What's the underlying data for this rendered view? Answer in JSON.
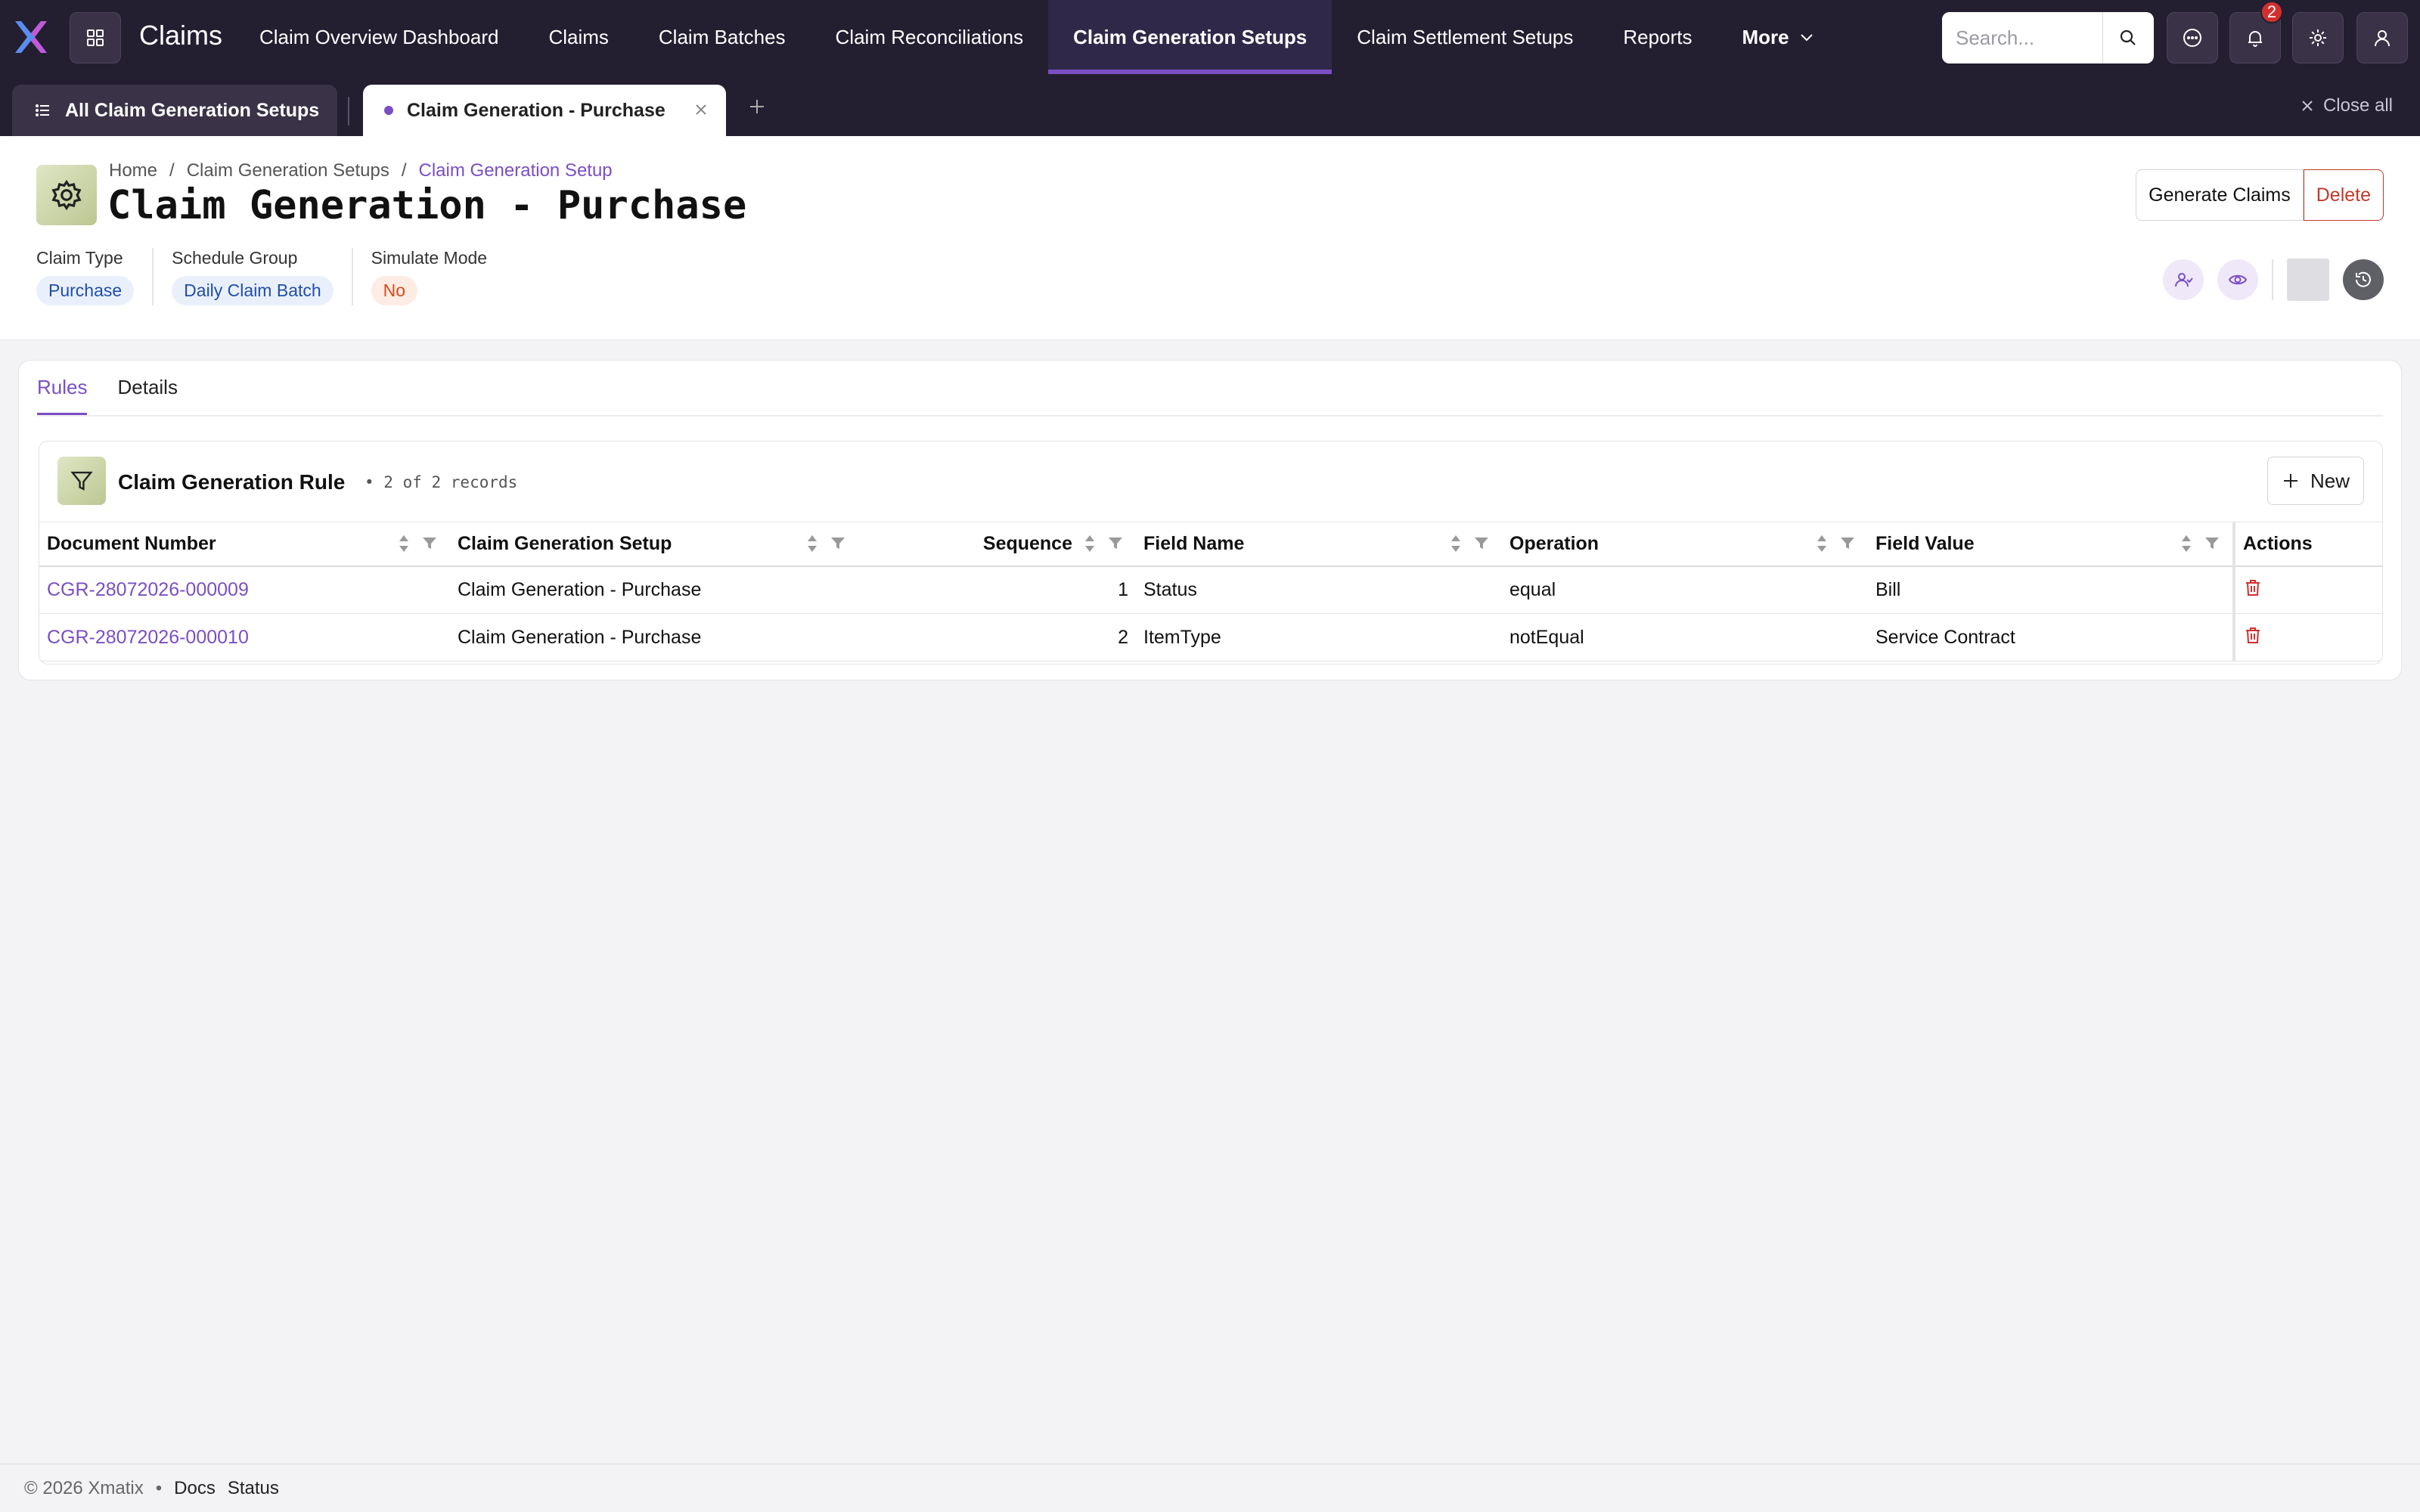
{
  "app": {
    "name": "Claims"
  },
  "nav": {
    "items": [
      {
        "label": "Claim Overview Dashboard"
      },
      {
        "label": "Claims"
      },
      {
        "label": "Claim Batches"
      },
      {
        "label": "Claim Reconciliations"
      },
      {
        "label": "Claim Generation Setups",
        "active": true
      },
      {
        "label": "Claim Settlement Setups"
      },
      {
        "label": "Reports"
      }
    ],
    "more_label": "More"
  },
  "search": {
    "placeholder": "Search..."
  },
  "notifications": {
    "count": "2"
  },
  "tabs": {
    "all_label": "All Claim Generation Setups",
    "current_label": "Claim Generation - Purchase",
    "close_all_label": "Close all"
  },
  "breadcrumb": {
    "home": "Home",
    "sep": "/",
    "parent": "Claim Generation Setups",
    "current": "Claim Generation Setup"
  },
  "page": {
    "title": "Claim Generation - Purchase"
  },
  "actions": {
    "generate_label": "Generate Claims",
    "delete_label": "Delete"
  },
  "properties": {
    "claim_type": {
      "label": "Claim Type",
      "value": "Purchase"
    },
    "schedule_group": {
      "label": "Schedule Group",
      "value": "Daily Claim Batch"
    },
    "simulate_mode": {
      "label": "Simulate Mode",
      "value": "No"
    }
  },
  "subtabs": [
    {
      "label": "Rules",
      "active": true
    },
    {
      "label": "Details"
    }
  ],
  "grid": {
    "title": "Claim Generation Rule",
    "count": "• 2 of 2 records",
    "new_label": "New",
    "columns": [
      "Document Number",
      "Claim Generation Setup",
      "Sequence",
      "Field Name",
      "Operation",
      "Field Value",
      "Actions"
    ],
    "rows": [
      {
        "document_number": "CGR-28072026-000009",
        "setup": "Claim Generation - Purchase",
        "sequence": "1",
        "field_name": "Status",
        "operation": "equal",
        "field_value": "Bill"
      },
      {
        "document_number": "CGR-28072026-000010",
        "setup": "Claim Generation - Purchase",
        "sequence": "2",
        "field_name": "ItemType",
        "operation": "notEqual",
        "field_value": "Service Contract"
      }
    ]
  },
  "footer": {
    "copyright": "© 2026 Xmatix",
    "dot": "•",
    "docs": "Docs",
    "status": "Status"
  },
  "colors": {
    "nav_bg": "#241e31",
    "accent": "#7a4fc4",
    "danger": "#c0392b",
    "link": "#7a4fc4"
  }
}
